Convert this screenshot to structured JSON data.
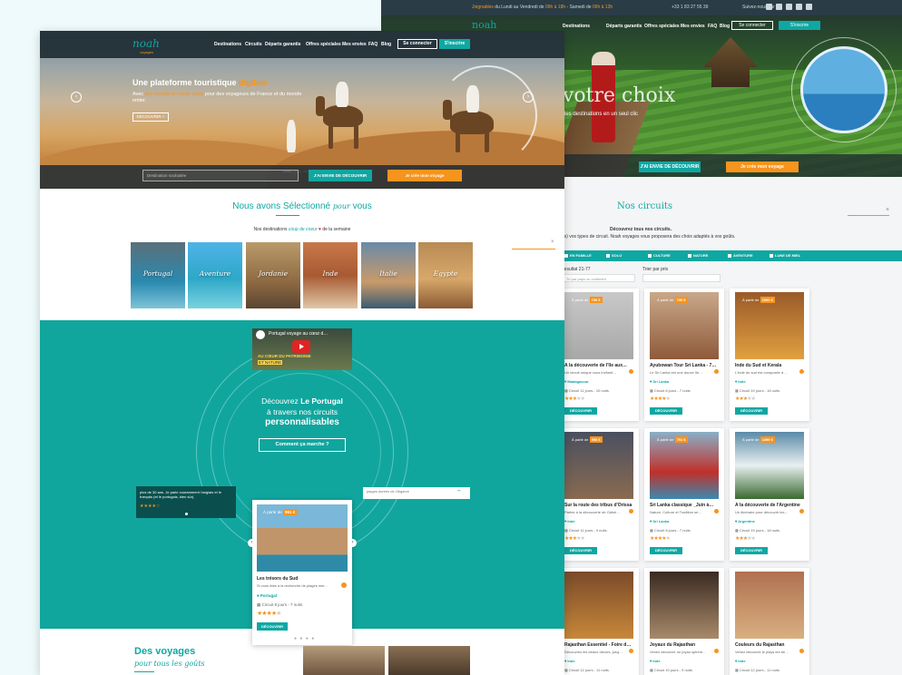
{
  "back": {
    "topbar": {
      "schedule_prefix": "Joignables",
      "schedule_text": " du Lundi au Vendredi de ",
      "schedule_hours1": "09h à 18h",
      "schedule_sat": " - Samedi de ",
      "schedule_hours2": "09h à 13h",
      "phone": "+33 1 83 27 55 39",
      "follow": "Suivez-nous sur"
    },
    "nav": {
      "logo": "noah",
      "items": [
        "Destinations",
        "Départs garantis",
        "Offres spéciales",
        "Mes envies",
        "FAQ",
        "Blog"
      ],
      "login": "Se connecter",
      "signup": "S'inscrire"
    },
    "hero": {
      "title": "votre choix",
      "subtitle": "des destinations en un seul clic"
    },
    "search": {
      "search_label": "J'AI ENVIE DE DÉCOUVRIR",
      "offer_label": "Je crée mon voyage"
    },
    "circuits": {
      "title_em": "Nos",
      "title": "circuits",
      "lead": "Découvrez tous nos circuits.",
      "desc": "(s) vos types de circuit. Noah voyages vous proposera des choix adaptés à vos goûts.",
      "filters": [
        "EN FAMILLE",
        "SOLO",
        "CULTURE",
        "NATURE",
        "AVENTURE",
        "LUNE DE MIEL"
      ],
      "sort1_label": "resultat 21-77",
      "sort1_value": "Tri par pays ou continent",
      "sort2_label": "Trier par prix"
    },
    "cards": [
      {
        "price_prefix": "À partir de",
        "price": "739 €",
        "title": "À la découverte de l'île aux…",
        "desc": "Un circuit unique vous invitant…",
        "location": "Madagascar",
        "duration": "Circuit 11 jours - 10 nuits",
        "rating": 3,
        "button": "DÉCOUVRIR"
      },
      {
        "price_prefix": "À partir de",
        "price": "730 €",
        "title": "Ayubowan Tour Sri Lanka - 7…",
        "desc": "Le Sri Lanka est une douce île…",
        "location": "Sri Lanka",
        "duration": "Circuit 8 jours - 7 nuits",
        "rating": 4,
        "button": "DÉCOUVRIR"
      },
      {
        "price_prefix": "À partir de",
        "price": "1000 €",
        "title": "Inde du Sud et Kerala",
        "desc": "L'Inde du sud est composée d…",
        "location": "Inde",
        "duration": "Circuit 19 jours - 18 nuits",
        "rating": 3,
        "button": "DÉCOUVRIR"
      },
      {
        "price_prefix": "À partir de",
        "price": "995 €",
        "title": "Sur la route des tribus d'Orissa",
        "desc": "Partez à la découverte de Odish…",
        "location": "Inde",
        "duration": "Circuit 11 jours - 9 nuits",
        "rating": 3,
        "button": "DÉCOUVRIR"
      },
      {
        "price_prefix": "À partir de",
        "price": "791 €",
        "title": "Sri Lanka classique _Juin à…",
        "desc": "Nature, Culture et Tradition se…",
        "location": "Sri Lanka",
        "duration": "Circuit 8 jours - 7 nuits",
        "rating": 4,
        "button": "DÉCOUVRIR"
      },
      {
        "price_prefix": "À partir de",
        "price": "1399 €",
        "title": "À la découverte de l'Argentine",
        "desc": "Un itinéraire pour découvrir les…",
        "location": "Argentine",
        "duration": "Circuit 19 jours - 18 nuits",
        "rating": 3,
        "button": "DÉCOUVRIR"
      },
      {
        "price_prefix": "",
        "price": "",
        "title": "Rajasthan Essentiel - Foire d…",
        "desc": "Découvrez les beaux décors, jusq…",
        "location": "Inde",
        "duration": "Circuit 12 jours - 11 nuits",
        "rating": 0,
        "button": ""
      },
      {
        "price_prefix": "",
        "price": "",
        "title": "Joyaux du Rajasthan",
        "desc": "Venez découvrir un joyau spirem…",
        "location": "Inde",
        "duration": "Circuit 10 jours - 9 nuits",
        "rating": 0,
        "button": ""
      },
      {
        "price_prefix": "",
        "price": "",
        "title": "Couleurs du Rajasthan",
        "desc": "Venez découvrir le plays les be…",
        "location": "Inde",
        "duration": "Circuit 12 jours - 11 nuits",
        "rating": 0,
        "button": ""
      }
    ]
  },
  "front": {
    "nav": {
      "logo": "noah",
      "logo_sub": "voyages",
      "items": [
        "Destinations",
        "Circuits",
        "Départs garantis",
        "Offres spéciales",
        "Mes envies",
        "FAQ",
        "Blog"
      ],
      "login": "Se connecter",
      "signup": "S'inscrire"
    },
    "hero": {
      "title_main": "Une plateforme touristique ",
      "title_accent": "digitale",
      "sub_pre": "Avec ",
      "sub_accent": "des circuits en mode entre",
      "sub_post": " pour des voyageurs de France et du monde entier.",
      "button": "DÉCOUVRIR +",
      "prev": "‹",
      "next": "›"
    },
    "search": {
      "placeholder": "Destination souhaitée",
      "search_btn": "J'AI ENVIE DE DÉCOUVRIR",
      "offer_btn": "Je crée mon voyage"
    },
    "selection": {
      "title_pre": "Nous avons Sélectionné ",
      "title_em": "pour",
      "title_post": " vous",
      "sub_pre": "Nos destinations ",
      "sub_em": "coup de coeur",
      "heart": "♥",
      "sub_post": " de la semaine",
      "close": "×",
      "destinations": [
        "Portugal",
        "Aventure",
        "Jordanie",
        "Inde",
        "Italie",
        "Egypte"
      ]
    },
    "video": {
      "title": "Portugal voyage au cœur d…",
      "caption1": "AU CŒUR DU PATRIMOINE",
      "caption2": "ET NATURE"
    },
    "discover": {
      "line1_pre": "Découvrez ",
      "line1_b": "Le Portugal",
      "line2": "à travers nos circuits",
      "line3": "personnalisables",
      "button": "Comment ça marche ?"
    },
    "review": {
      "text": "plus de 30 ans. Je parle couramment l'anglais et le français (et le portugais, bien sûr).",
      "stars": "★★★★☆"
    },
    "review2": {
      "text": "plages dorées de l'Algarve",
      "quote": "\"\""
    },
    "card": {
      "price_prefix": "À partir de",
      "price": "991 €",
      "title": "Les trésors du Sud",
      "desc": "Si vous êtes à la recherche de plages mer…",
      "location": "Portugal",
      "duration": "Circuit 8 jours - 7 nuits",
      "rating": 4,
      "button": "DÉCOUVRIR",
      "pager": "● ● ● ●"
    },
    "voyages": {
      "title": "Des voyages",
      "sub": "pour tous les goûts"
    }
  }
}
